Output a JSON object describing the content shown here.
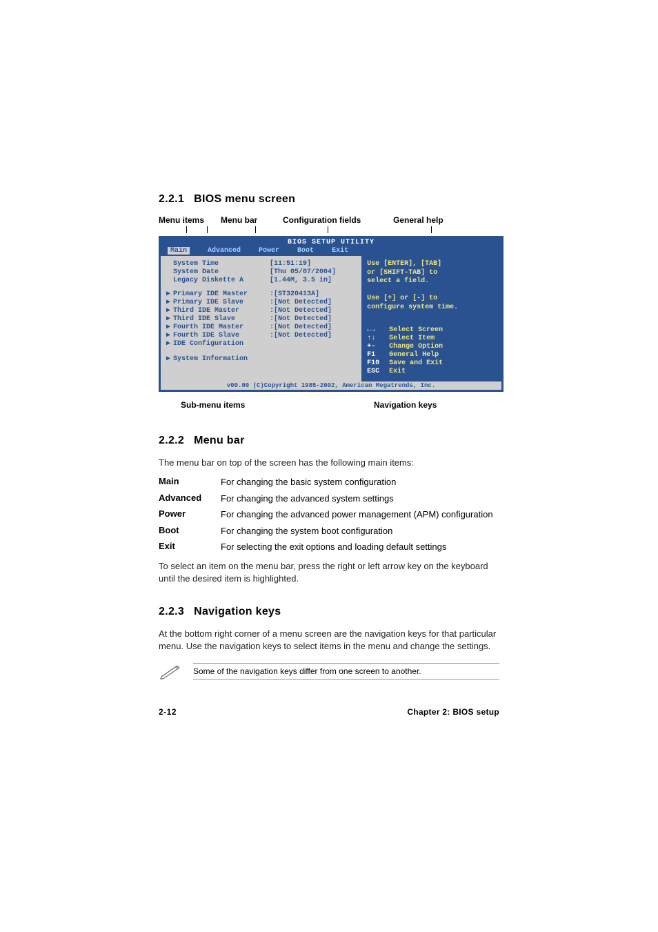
{
  "sections": {
    "s1": {
      "num": "2.2.1",
      "title": "BIOS menu screen"
    },
    "s2": {
      "num": "2.2.2",
      "title": "Menu bar"
    },
    "s3": {
      "num": "2.2.3",
      "title": "Navigation keys"
    }
  },
  "diagram_labels": {
    "menu_items": "Menu items",
    "menu_bar": "Menu bar",
    "config_fields": "Configuration fields",
    "general_help": "General help",
    "submenu_items": "Sub-menu items",
    "navigation_keys": "Navigation keys"
  },
  "bios": {
    "title": "BIOS SETUP UTILITY",
    "tabs": {
      "main": "Main",
      "advanced": "Advanced",
      "power": "Power",
      "boot": "Boot",
      "exit": "Exit"
    },
    "top_items": [
      {
        "label": "System Time",
        "value": "[11:51:19]"
      },
      {
        "label": "System Date",
        "value": "[Thu 05/07/2004]"
      },
      {
        "label": "Legacy Diskette A",
        "value": "[1.44M, 3.5 in]"
      }
    ],
    "ide_items": [
      {
        "label": "Primary IDE Master",
        "value": ":[ST320413A]"
      },
      {
        "label": "Primary IDE Slave",
        "value": ":[Not Detected]"
      },
      {
        "label": "Third IDE Master",
        "value": ":[Not Detected]"
      },
      {
        "label": "Third IDE Slave",
        "value": ":[Not Detected]"
      },
      {
        "label": "Fourth IDE Master",
        "value": ":[Not Detected]"
      },
      {
        "label": "Fourth IDE Slave",
        "value": ":[Not Detected]"
      },
      {
        "label": "IDE Configuration",
        "value": ""
      }
    ],
    "sysinfo": {
      "label": "System Information"
    },
    "help": "Use [ENTER], [TAB]\nor [SHIFT-TAB] to\nselect a field.\n\nUse [+] or [-] to\nconfigure system time.",
    "nav": [
      {
        "key": "←→",
        "action": "Select Screen"
      },
      {
        "key": "↑↓",
        "action": "Select Item"
      },
      {
        "key": "+-",
        "action": "Change Option"
      },
      {
        "key": "F1",
        "action": "General Help"
      },
      {
        "key": "F10",
        "action": "Save and Exit"
      },
      {
        "key": "ESC",
        "action": "Exit"
      }
    ],
    "footer": "v00.00 (C)Copyright 1985-2002, American Megatrends, Inc."
  },
  "menubar_intro": "The menu bar on top of the screen has the following main items:",
  "menubar_items": [
    {
      "name": "Main",
      "desc": "For changing the basic system configuration"
    },
    {
      "name": "Advanced",
      "desc": "For changing the advanced system settings"
    },
    {
      "name": "Power",
      "desc": "For changing the advanced power management (APM) configuration"
    },
    {
      "name": "Boot",
      "desc": "For changing the system boot configuration"
    },
    {
      "name": "Exit",
      "desc": "For selecting the exit options and loading default settings"
    }
  ],
  "menubar_outro": "To select an item on the menu bar, press the right or left arrow key on the keyboard until the desired item is highlighted.",
  "navkeys_body": "At the bottom right corner of a menu screen are the navigation keys for that particular menu. Use the navigation keys to select items in the menu and change the settings.",
  "note": "Some of the navigation keys differ from one screen to another.",
  "footer": {
    "left": "2-12",
    "right": "Chapter 2: BIOS setup"
  }
}
